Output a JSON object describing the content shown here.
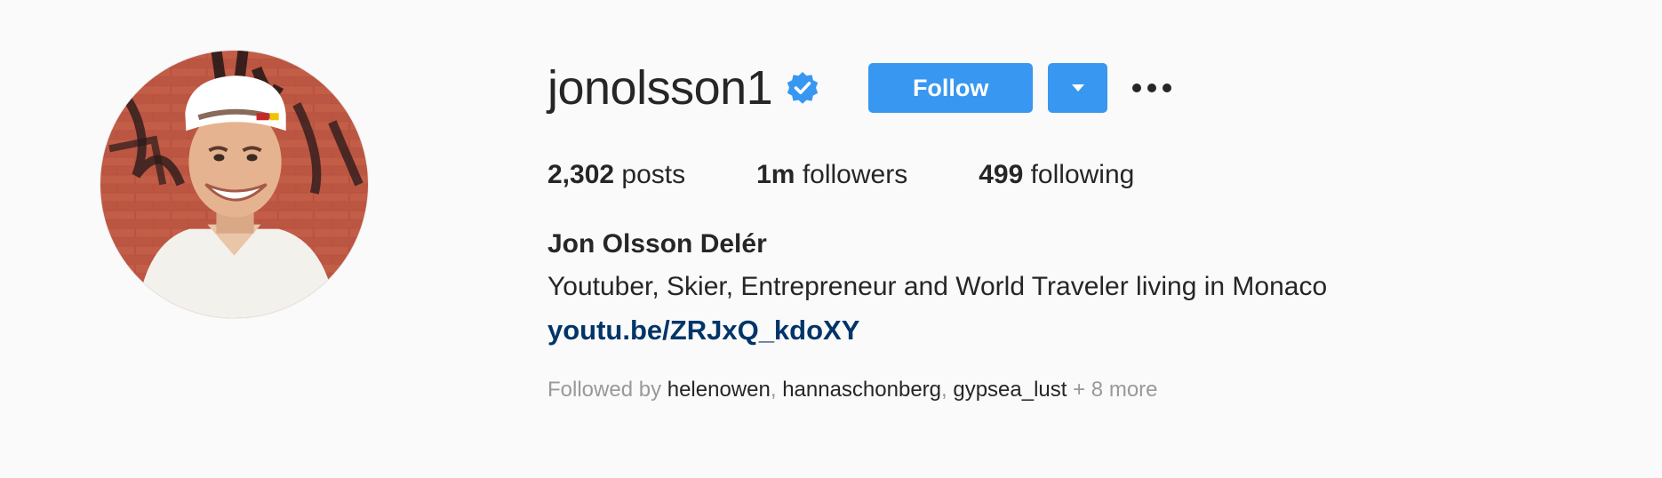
{
  "profile": {
    "username": "jonolsson1",
    "verified_icon": "verified-badge-icon",
    "full_name": "Jon Olsson Delér",
    "bio": "Youtuber, Skier, Entrepreneur and World Traveler living in Monaco",
    "link": "youtu.be/ZRJxQ_kdoXY"
  },
  "actions": {
    "follow_label": "Follow",
    "dropdown_icon": "caret-down-icon",
    "more_icon": "more-options-icon"
  },
  "stats": {
    "posts_count": "2,302",
    "posts_label": " posts",
    "followers_count": "1m",
    "followers_label": " followers",
    "following_count": "499",
    "following_label": " following"
  },
  "followed_by": {
    "prefix": "Followed by ",
    "users": [
      "helenowen",
      "hannaschonberg",
      "gypsea_lust"
    ],
    "separator": ", ",
    "more": " + 8 more"
  },
  "colors": {
    "background": "#fafafa",
    "accent": "#3897f0",
    "link": "#003569",
    "text": "#262626",
    "muted": "#999999"
  }
}
